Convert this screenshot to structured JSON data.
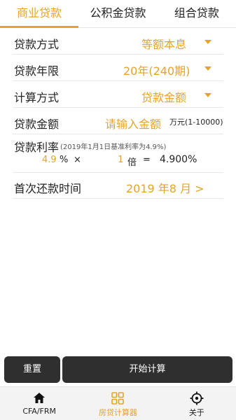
{
  "colors": {
    "accent": "#e5a428",
    "button_bg": "#2f2f2f",
    "nav_bg": "#f3f3f3"
  },
  "tabs": [
    {
      "label": "商业贷款",
      "active": true
    },
    {
      "label": "公积金贷款",
      "active": false
    },
    {
      "label": "组合贷款",
      "active": false
    }
  ],
  "form": {
    "repayment_method": {
      "label": "贷款方式",
      "value": "等额本息",
      "icon": "chevron-down-icon"
    },
    "loan_term": {
      "label": "贷款年限",
      "value": "20年(240期)",
      "icon": "chevron-down-icon"
    },
    "calc_method": {
      "label": "计算方式",
      "value": "贷款金额",
      "icon": "chevron-down-icon"
    },
    "loan_amount": {
      "label": "贷款金额",
      "placeholder": "请输入金额",
      "unit": "万元(1-10000)"
    },
    "rate": {
      "label": "贷款利率",
      "hint": "(2019年1月1日基准利率为4.9%)",
      "base_value": "4.9",
      "percent_sign": "%",
      "multiply_sign": "×",
      "multiplier": "1",
      "multiplier_unit": "倍",
      "equals_sign": "=",
      "result": "4.900%"
    },
    "first_payment": {
      "label": "首次还款时间",
      "value": "2019 年8 月  >"
    }
  },
  "actions": {
    "reset_label": "重置",
    "start_label": "开始计算"
  },
  "bottom_nav": [
    {
      "label": "CFA/FRM",
      "icon": "home-icon",
      "active": false
    },
    {
      "label": "房贷计算器",
      "icon": "grid-icon",
      "active": true
    },
    {
      "label": "关于",
      "icon": "crosshair-icon",
      "active": false
    }
  ]
}
